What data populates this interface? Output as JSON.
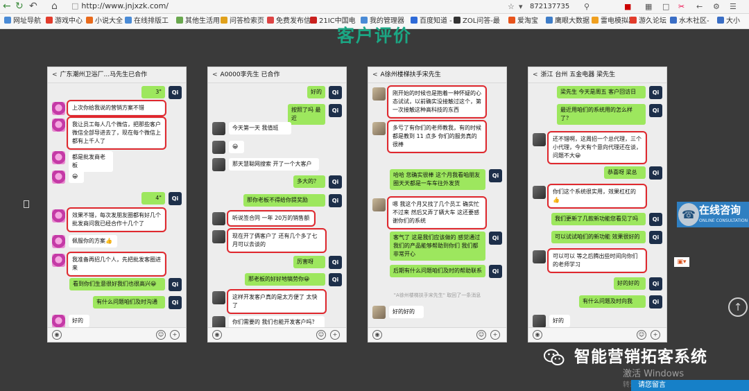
{
  "browser": {
    "url": "http://www.jnjxzk.com/",
    "search_value": "872137735",
    "bookmarks": [
      {
        "label": "网址导航",
        "color": "#4a8bd6"
      },
      {
        "label": "游戏中心",
        "color": "#e23c2c"
      },
      {
        "label": "小说大全",
        "color": "#e86a1c"
      },
      {
        "label": "在线排版工",
        "color": "#4a8bd6"
      },
      {
        "label": "其他生活用",
        "color": "#6aa84f"
      },
      {
        "label": "问答检索页",
        "color": "#e0a11c"
      },
      {
        "label": "免费发布信",
        "color": "#d44"
      },
      {
        "label": "21IC中国电",
        "color": "#c9211e"
      },
      {
        "label": "我的管理器",
        "color": "#4a8bd6"
      },
      {
        "label": "百度知道 -",
        "color": "#2f6bd8"
      },
      {
        "label": "ZOL问答-最",
        "color": "#333"
      },
      {
        "label": "爱淘宝",
        "color": "#e8541c"
      },
      {
        "label": "鹰眼大数据",
        "color": "#3e7dc8"
      },
      {
        "label": "雷电模拟器",
        "color": "#f0a020"
      },
      {
        "label": "游久论坛",
        "color": "#e23c2c"
      },
      {
        "label": "水木社区-",
        "color": "#3a6ec5"
      },
      {
        "label": "大小",
        "color": "#3a6ec5"
      }
    ]
  },
  "page": {
    "title": "客户评价",
    "consult_title": "在线咨询",
    "consult_sub": "ONLINE CONSULTATION",
    "brand": "智能营销拓客系统",
    "activate": "激活 Windows",
    "activate_sub": "转到",
    "message_button": "请您留言"
  },
  "phones": [
    {
      "header": "广东潮州卫浴厂...马先生已合作",
      "messages": [
        {
          "side": "right",
          "text": "3\"",
          "voice": true
        },
        {
          "side": "left",
          "text": "上次你给我说的营销方案不错",
          "red": true
        },
        {
          "side": "left",
          "text": "我让员工每人几个微信，把那些客户微信全部导进去了，现在每个微信上都有上千人了",
          "red": true
        },
        {
          "side": "left",
          "text": "都是批发商老板"
        },
        {
          "side": "left",
          "text": "😀"
        },
        {
          "side": "right",
          "text": "4\"",
          "voice": true
        },
        {
          "side": "left",
          "text": "效果不错，每次发朋友圈都有好几个批发商问我已经合作十几个了",
          "red": true
        },
        {
          "side": "left",
          "text": "佩服你的方案👍"
        },
        {
          "side": "left",
          "text": "我准备再招几个人，先把批发客圈进来",
          "red": true
        },
        {
          "side": "right",
          "text": "看到你们生意很好我们也很高兴😀"
        },
        {
          "side": "right",
          "text": "有什么问题咱们及时沟通"
        },
        {
          "side": "left",
          "text": "好的"
        }
      ]
    },
    {
      "header": "A0000李先生  已合作",
      "messages": [
        {
          "side": "right",
          "text": "好的"
        },
        {
          "side": "right",
          "text": "按照了吗  最近"
        },
        {
          "side": "left",
          "text": "今天第一天 我值班"
        },
        {
          "side": "left",
          "text": "😀"
        },
        {
          "side": "left",
          "text": "那天慧聪网搜索 开了一个大客户"
        },
        {
          "side": "right",
          "text": "多大的？"
        },
        {
          "side": "right",
          "text": "那你老板不得给你提奖励"
        },
        {
          "side": "left",
          "text": "听说签合同 一年 20万的销售额",
          "red": true
        },
        {
          "side": "left",
          "text": "现在开了俩客户了 还有几个多了七月可以去谈的",
          "red": true
        },
        {
          "side": "right",
          "text": "厉害呀"
        },
        {
          "side": "right",
          "text": "那老板的好好地犒劳你😀"
        },
        {
          "side": "left",
          "text": "这样开发客户真的是太方便了 太快了",
          "red": true
        },
        {
          "side": "left",
          "text": "你们需要的 我们也能开发客户吗？"
        }
      ]
    },
    {
      "header": "A徐州楼梯扶手宋先生",
      "messages": [
        {
          "side": "left",
          "text": "刚开始的时候也是抱着一种怀疑的心态试试，以前确实没接触过这个，第一次接触这种高科技的东西",
          "red": true
        },
        {
          "side": "left",
          "text": "多亏了有你们的老师教我，有的时候都是教到 11 点多 你们的服务真的很棒",
          "red": true
        },
        {
          "side": "right",
          "text": "哈哈  您确实很棒 这个月我看咱朋友圈天天都是一车车往外发货"
        },
        {
          "side": "left",
          "text": "嗯 我这个月又找了几个员工 确实忙不过来 然后又弄了辆大车 这还要感谢你们的系统",
          "red": true
        },
        {
          "side": "right",
          "text": "客气了  这是我们应该做的 感觉通过我们的产品能够帮助到你们 我们都非常开心"
        },
        {
          "side": "right",
          "text": "后期有什么问题咱们及时的帮助联系"
        },
        {
          "side": "system",
          "text": "\"A徐州楼梯扶手宋先生\" 取回了一条消息"
        },
        {
          "side": "left",
          "text": "好的好的"
        }
      ]
    },
    {
      "header": "浙江 台州 五金电器 梁先生",
      "messages": [
        {
          "side": "right",
          "text": "梁先生  今天是周五 客户回访日"
        },
        {
          "side": "right",
          "text": "最近用咱们的系统用的怎么样了？"
        },
        {
          "side": "left",
          "text": "还不错啊，这周招一个总代理，三个小代理，今天有个意向代理还在谈，问题不大😀",
          "red": true
        },
        {
          "side": "right",
          "text": "恭喜呀  梁总"
        },
        {
          "side": "left",
          "text": "你们这个系统很实用，效果杠杠的👍",
          "red": true
        },
        {
          "side": "right",
          "text": "我们更新了几款新功能您看见了吗"
        },
        {
          "side": "right",
          "text": "可以试试咱们的新功能 效果很好的"
        },
        {
          "side": "left",
          "text": "可以可以 等之后腾出些时间向你们的老师学习",
          "red": true
        },
        {
          "side": "right",
          "text": "好的好的"
        },
        {
          "side": "right",
          "text": "有什么问题及时向我"
        },
        {
          "side": "left",
          "text": "好的"
        }
      ]
    }
  ]
}
